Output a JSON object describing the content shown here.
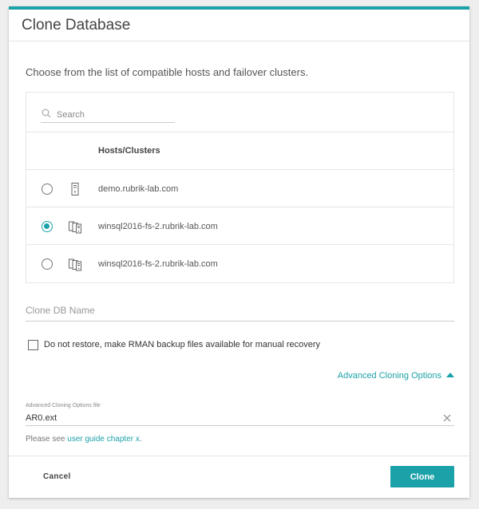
{
  "dialog": {
    "title": "Clone Database",
    "intro": "Choose from the list of compatible hosts and failover clusters."
  },
  "search": {
    "placeholder": "Search",
    "icon": "search-icon"
  },
  "table": {
    "column_header": "Hosts/Clusters",
    "rows": [
      {
        "name": "demo.rubrik-lab.com",
        "icon": "host-icon",
        "selected": false
      },
      {
        "name": "winsql2016-fs-2.rubrik-lab.com",
        "icon": "cluster-icon",
        "selected": true
      },
      {
        "name": "winsql2016-fs-2.rubrik-lab.com",
        "icon": "cluster-icon",
        "selected": false
      }
    ]
  },
  "clone_db_name": {
    "placeholder": "Clone DB Name",
    "value": ""
  },
  "rman_option": {
    "label": "Do not restore, make RMAN backup files available for manual recovery",
    "checked": false
  },
  "advanced": {
    "toggle_label": "Advanced Cloning Options",
    "file_label": "Advanced Cloning Options file",
    "file_value": "AR0.ext",
    "hint_prefix": "Please see ",
    "hint_link": "user guide chapter x",
    "hint_suffix": "."
  },
  "footer": {
    "cancel_label": "Cancel",
    "clone_label": "Clone"
  },
  "colors": {
    "accent": "#1ba1a8"
  }
}
